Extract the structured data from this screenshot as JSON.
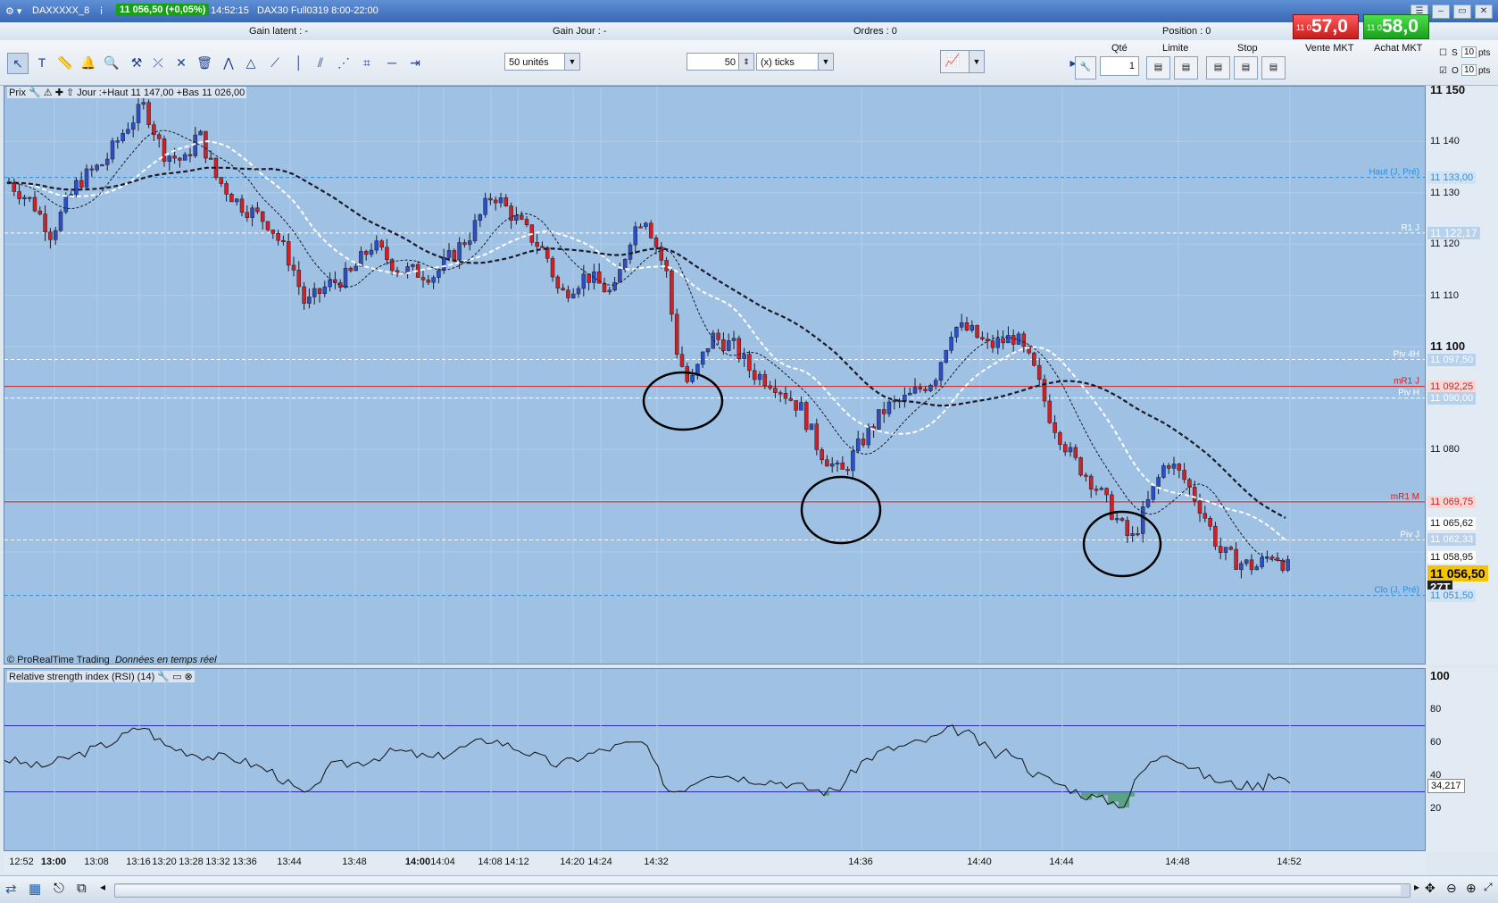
{
  "window": {
    "instrument": "DAXXXXX_8",
    "last_price": "11 056,50 (+0,05%)",
    "time": "14:52:15",
    "contract": "DAX30 Full0319 8:00-22:00"
  },
  "infobar": {
    "gain_latent": "Gain latent : -",
    "gain_jour": "Gain Jour : -",
    "ordres": "Ordres : 0",
    "position": "Position : 0"
  },
  "toolbar": {
    "units_select": "50 unités",
    "ticks_value": "50",
    "ticks_select": "(x) ticks",
    "icons": [
      "pointer-icon",
      "text-icon",
      "ruler-icon",
      "alert-icon",
      "zoom-icon",
      "line-tools-icon",
      "fibonacci-icon",
      "trash-icon",
      "pattern-icon",
      "triangle-icon",
      "trendline-icon",
      "vertical-line-icon",
      "channel-icon",
      "fan-icon",
      "gann-icon",
      "horizontal-line-icon"
    ]
  },
  "order_panel": {
    "qte_label": "Qté",
    "qte_value": "1",
    "limite_label": "Limite",
    "stop_label": "Stop",
    "vente_label": "Vente MKT",
    "achat_label": "Achat MKT",
    "vente_small": "11 0",
    "vente_big": "57,0",
    "achat_small": "11 0",
    "achat_big": "58,0",
    "s_label": "S",
    "o_label": "O",
    "s_pts": "10",
    "o_pts": "10",
    "pts_label": "pts"
  },
  "chart_header": {
    "prix": "Prix",
    "info": "Jour :+Haut 11 147,00 +Bas 11 026,00",
    "copyright": "© ProRealTime Trading",
    "realtime": "Données en temps réel"
  },
  "price_levels": {
    "ticks": [
      "11 150",
      "11 140",
      "11 130",
      "11 120",
      "11 110",
      "11 100",
      "11 090",
      "11 080"
    ],
    "haut": {
      "label": "Haut (J, Pré)",
      "value": "11 133,00"
    },
    "r1": {
      "label": "R1 J",
      "value": "11 122,17"
    },
    "piv4h": {
      "label": "Piv 4H",
      "value": "11 097,50"
    },
    "mr1j": {
      "label": "mR1 J",
      "value": "11 092,25"
    },
    "pivh": {
      "label": "Piv H",
      "value": "11 090,00"
    },
    "mr1m": {
      "label": "mR1 M",
      "value": "11 069,75"
    },
    "ma_value": "11 065,62",
    "pivj": {
      "label": "Piv J",
      "value": "11 062,33"
    },
    "other_value": "11 058,95",
    "current": "11 056,50",
    "timer": "27T",
    "clo": {
      "label": "Clo (J, Pré)",
      "value": "11 051,50"
    }
  },
  "rsi": {
    "title": "Relative strength index (RSI) (14)",
    "ticks": [
      "100",
      "80",
      "60",
      "40",
      "20"
    ],
    "value": "34,217"
  },
  "time_axis": [
    "12:52",
    "13:00",
    "13:08",
    "13:16",
    "13:20",
    "13:28",
    "13:32",
    "13:36",
    "13:44",
    "13:48",
    "14:00",
    "14:04",
    "14:08",
    "14:12",
    "14:20",
    "14:24",
    "14:32",
    "14:36",
    "14:40",
    "14:44",
    "14:48",
    "14:52"
  ],
  "colors": {
    "chart_bg": "#9fc1e3",
    "bull": "#2e4fc4",
    "bear": "#d42020",
    "sell": "#d62020",
    "buy": "#22b022"
  }
}
